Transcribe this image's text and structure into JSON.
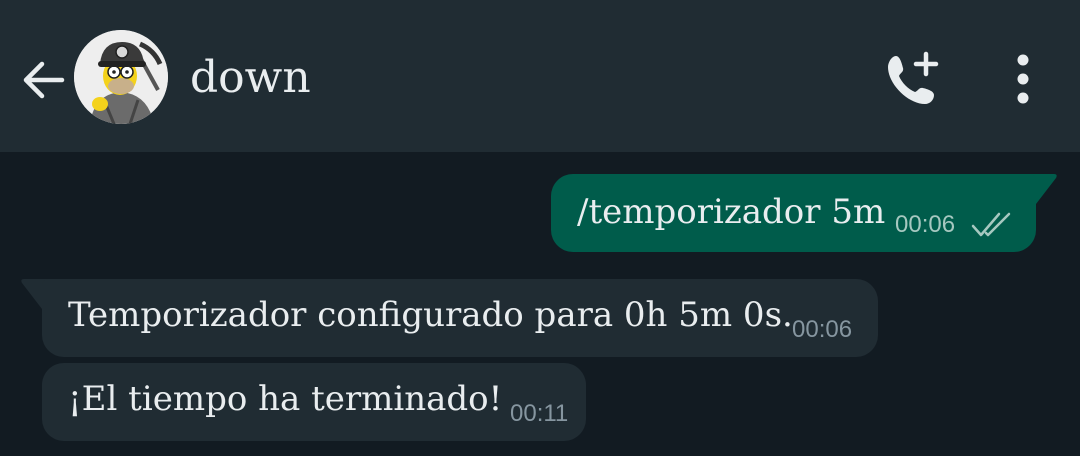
{
  "header": {
    "chat_name": "down",
    "back_icon": "arrow-left-icon",
    "call_icon": "phone-add-icon",
    "menu_icon": "more-vertical-icon",
    "bg_color": "#202c33"
  },
  "messages": [
    {
      "direction": "outgoing",
      "text": "/temporizador 5m",
      "time": "00:06",
      "status": "read"
    },
    {
      "direction": "incoming",
      "text": "Temporizador configurado para 0h 5m 0s.",
      "time": "00:06"
    },
    {
      "direction": "incoming",
      "text": "¡El tiempo ha terminado!",
      "time": "00:11"
    }
  ],
  "colors": {
    "background": "#121b22",
    "outgoing_bubble": "#005c4b",
    "incoming_bubble": "#202c33",
    "text": "#e9edef",
    "timestamp": "#8696a0"
  }
}
